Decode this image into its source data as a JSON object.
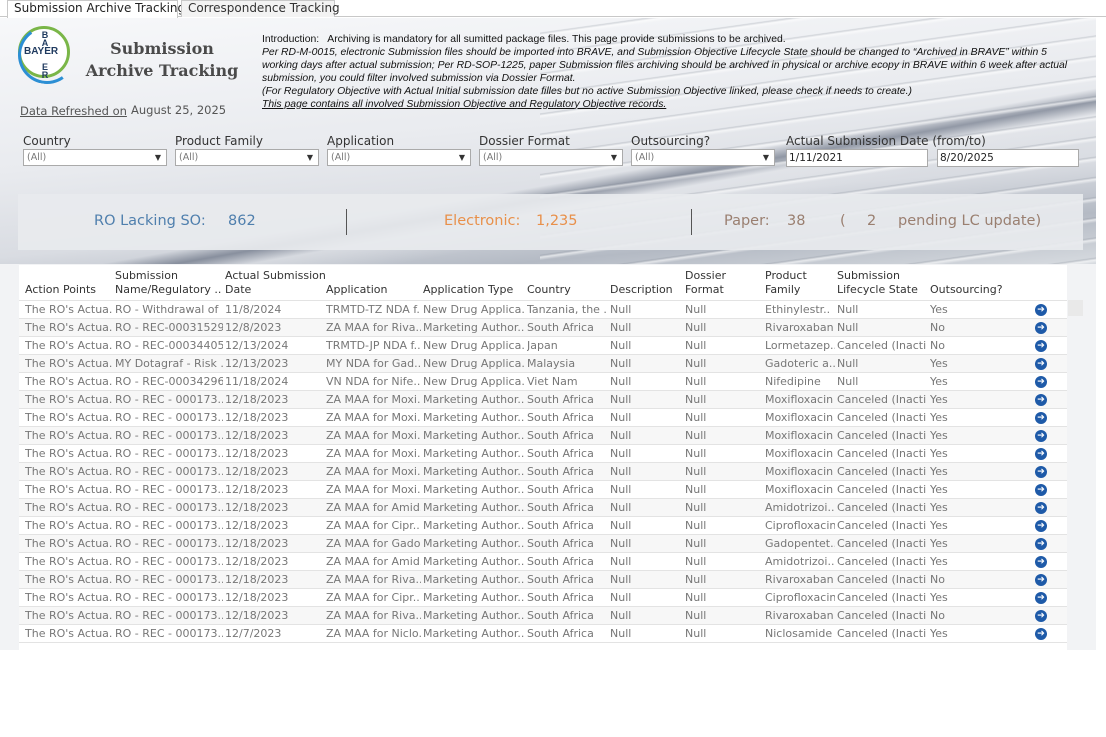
{
  "tabs": [
    {
      "label": "Submission Archive Tracking",
      "active": true
    },
    {
      "label": "Correspondence Tracking",
      "active": false
    }
  ],
  "header": {
    "logo_text": "BAYER",
    "title": "Submission Archive Tracking",
    "refreshed_label": "Data Refreshed on",
    "refreshed_date": "August 25, 2025"
  },
  "intro": {
    "heading": "Introduction:",
    "line1": "Archiving is mandatory for all sumitted package files. This page provide submissions to be archived.",
    "para": "Per RD-M-0015, electronic Submission files should be imported into BRAVE, and Submission Objective Lifecycle State should be changed to “Archived in BRAVE” within 5 working days after actual submission; Per RD-SOP-1225, paper Submission files archiving should be archived in physical or archive ecopy in BRAVE within 6 week after actual submission, you could filter involved submission via Dossier Format.",
    "note": "(For Regulatory Objective with Actual Initial submission date filles but no active Submission Objective linked, please check if needs to create.)",
    "footer": "This page contains all involved Submission Objective and Regulatory Objective records."
  },
  "filters": {
    "country": {
      "label": "Country",
      "value": "(All)"
    },
    "product_family": {
      "label": "Product Family",
      "value": "(All)"
    },
    "application": {
      "label": "Application",
      "value": "(All)"
    },
    "dossier_format": {
      "label": "Dossier Format",
      "value": "(All)"
    },
    "outsourcing": {
      "label": "Outsourcing?",
      "value": "(All)"
    },
    "date": {
      "label": "Actual Submission Date (from/to)",
      "from": "1/11/2021",
      "to": "8/20/2025"
    }
  },
  "kpis": {
    "ro_label": "RO Lacking SO:",
    "ro_value": "862",
    "elec_label": "Electronic:",
    "elec_value": "1,235",
    "paper_label": "Paper:",
    "paper_value": "38",
    "paren_open": "(",
    "pending_value": "2",
    "pending_label": "pending LC update)"
  },
  "colors": {
    "ro": "#4f7fad",
    "electronic": "#e8904a",
    "paper": "#9a7f70",
    "action_icon": "#1e5aa8"
  },
  "table": {
    "headers": [
      [
        "",
        "Action Points"
      ],
      [
        "Submission",
        "Name/Regulatory .."
      ],
      [
        "Actual Submission",
        "Date"
      ],
      [
        "",
        "Application"
      ],
      [
        "",
        "Application Type"
      ],
      [
        "",
        "Country"
      ],
      [
        "",
        "Description"
      ],
      [
        "Dossier",
        "Format"
      ],
      [
        "Product",
        "Family"
      ],
      [
        "Submission",
        "Lifecycle State"
      ],
      [
        "",
        "Outsourcing?"
      ]
    ],
    "rows": [
      [
        "The RO's Actua..",
        "RO - Withdrawal of ..",
        "11/8/2024",
        "TRMTD-TZ NDA f..",
        "New Drug Applica..",
        "Tanzania, the ..",
        "Null",
        "Null",
        "Ethinylestr..",
        "Null",
        "Yes"
      ],
      [
        "The RO's Actua..",
        "RO - REC-00031529..",
        "12/8/2023",
        "ZA MAA for Riva..",
        "Marketing Author..",
        "South Africa",
        "Null",
        "Null",
        "Rivaroxaban",
        "Null",
        "No"
      ],
      [
        "The RO's Actua..",
        "RO - REC-00034405..",
        "12/13/2024",
        "TRMTD-JP NDA f..",
        "New Drug Applica..",
        "Japan",
        "Null",
        "Null",
        "Lormetazep..",
        "Canceled (Inacti..",
        "No"
      ],
      [
        "The RO's Actua..",
        "MY Dotagraf - Risk ..",
        "12/13/2023",
        "MY NDA for Gad..",
        "New Drug Applica..",
        "Malaysia",
        "Null",
        "Null",
        "Gadoteric a..",
        "Null",
        "Yes"
      ],
      [
        "The RO's Actua..",
        "RO - REC-00034296..",
        "11/18/2024",
        "VN NDA for Nife..",
        "New Drug Applica..",
        "Viet Nam",
        "Null",
        "Null",
        "Nifedipine",
        "Null",
        "Yes"
      ],
      [
        "The RO's Actua..",
        "RO - REC - 000173..",
        "12/18/2023",
        "ZA MAA for Moxi..",
        "Marketing Author..",
        "South Africa",
        "Null",
        "Null",
        "Moxifloxacin",
        "Canceled (Inacti..",
        "Yes"
      ],
      [
        "The RO's Actua..",
        "RO - REC - 000173..",
        "12/18/2023",
        "ZA MAA for Moxi..",
        "Marketing Author..",
        "South Africa",
        "Null",
        "Null",
        "Moxifloxacin",
        "Canceled (Inacti..",
        "Yes"
      ],
      [
        "The RO's Actua..",
        "RO - REC - 000173..",
        "12/18/2023",
        "ZA MAA for Moxi..",
        "Marketing Author..",
        "South Africa",
        "Null",
        "Null",
        "Moxifloxacin",
        "Canceled (Inacti..",
        "Yes"
      ],
      [
        "The RO's Actua..",
        "RO - REC - 000173..",
        "12/18/2023",
        "ZA MAA for Moxi..",
        "Marketing Author..",
        "South Africa",
        "Null",
        "Null",
        "Moxifloxacin",
        "Canceled (Inacti..",
        "Yes"
      ],
      [
        "The RO's Actua..",
        "RO - REC - 000173..",
        "12/18/2023",
        "ZA MAA for Moxi..",
        "Marketing Author..",
        "South Africa",
        "Null",
        "Null",
        "Moxifloxacin",
        "Canceled (Inacti..",
        "Yes"
      ],
      [
        "The RO's Actua..",
        "RO - REC - 000173..",
        "12/18/2023",
        "ZA MAA for Moxi..",
        "Marketing Author..",
        "South Africa",
        "Null",
        "Null",
        "Moxifloxacin",
        "Canceled (Inacti..",
        "Yes"
      ],
      [
        "The RO's Actua..",
        "RO - REC - 000173..",
        "12/18/2023",
        "ZA MAA for Amid..",
        "Marketing Author..",
        "South Africa",
        "Null",
        "Null",
        "Amidotrizoi..",
        "Canceled (Inacti..",
        "Yes"
      ],
      [
        "The RO's Actua..",
        "RO - REC - 000173..",
        "12/18/2023",
        "ZA MAA for Cipr..",
        "Marketing Author..",
        "South Africa",
        "Null",
        "Null",
        "Ciprofloxacin",
        "Canceled (Inacti..",
        "Yes"
      ],
      [
        "The RO's Actua..",
        "RO - REC - 000173..",
        "12/18/2023",
        "ZA MAA for Gado..",
        "Marketing Author..",
        "South Africa",
        "Null",
        "Null",
        "Gadopentet..",
        "Canceled (Inacti..",
        "Yes"
      ],
      [
        "The RO's Actua..",
        "RO - REC - 000173..",
        "12/18/2023",
        "ZA MAA for Amid..",
        "Marketing Author..",
        "South Africa",
        "Null",
        "Null",
        "Amidotrizoi..",
        "Canceled (Inacti..",
        "Yes"
      ],
      [
        "The RO's Actua..",
        "RO - REC - 000173..",
        "12/18/2023",
        "ZA MAA for Riva..",
        "Marketing Author..",
        "South Africa",
        "Null",
        "Null",
        "Rivaroxaban",
        "Canceled (Inacti..",
        "No"
      ],
      [
        "The RO's Actua..",
        "RO - REC - 000173..",
        "12/18/2023",
        "ZA MAA for Cipr..",
        "Marketing Author..",
        "South Africa",
        "Null",
        "Null",
        "Ciprofloxacin",
        "Canceled (Inacti..",
        "Yes"
      ],
      [
        "The RO's Actua..",
        "RO - REC - 000173..",
        "12/18/2023",
        "ZA MAA for Riva..",
        "Marketing Author..",
        "South Africa",
        "Null",
        "Null",
        "Rivaroxaban",
        "Canceled (Inacti..",
        "No"
      ],
      [
        "The RO's Actua..",
        "RO - REC - 000173..",
        "12/7/2023",
        "ZA MAA for Niclo..",
        "Marketing Author..",
        "South Africa",
        "Null",
        "Null",
        "Niclosamide",
        "Canceled (Inacti..",
        "Yes"
      ]
    ],
    "row_icon": "arrow-circle-right-icon"
  }
}
